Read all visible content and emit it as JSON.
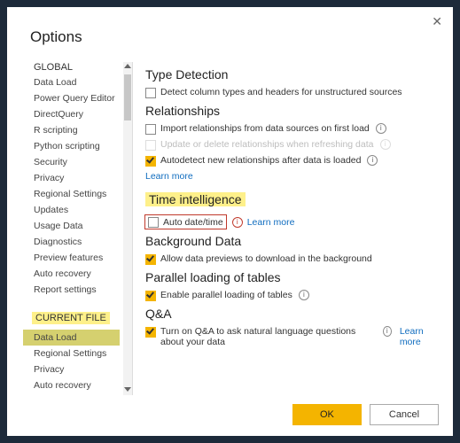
{
  "title": "Options",
  "sidebar": {
    "sections": [
      {
        "label": "GLOBAL",
        "highlight": false,
        "items": [
          {
            "label": "Data Load",
            "selected": false
          },
          {
            "label": "Power Query Editor",
            "selected": false
          },
          {
            "label": "DirectQuery",
            "selected": false
          },
          {
            "label": "R scripting",
            "selected": false
          },
          {
            "label": "Python scripting",
            "selected": false
          },
          {
            "label": "Security",
            "selected": false
          },
          {
            "label": "Privacy",
            "selected": false
          },
          {
            "label": "Regional Settings",
            "selected": false
          },
          {
            "label": "Updates",
            "selected": false
          },
          {
            "label": "Usage Data",
            "selected": false
          },
          {
            "label": "Diagnostics",
            "selected": false
          },
          {
            "label": "Preview features",
            "selected": false
          },
          {
            "label": "Auto recovery",
            "selected": false
          },
          {
            "label": "Report settings",
            "selected": false
          }
        ]
      },
      {
        "label": "CURRENT FILE",
        "highlight": true,
        "items": [
          {
            "label": "Data Load",
            "selected": true
          },
          {
            "label": "Regional Settings",
            "selected": false
          },
          {
            "label": "Privacy",
            "selected": false
          },
          {
            "label": "Auto recovery",
            "selected": false
          }
        ]
      }
    ]
  },
  "content": {
    "sections": [
      {
        "heading": "Type Detection",
        "highlight": false,
        "options": [
          {
            "label": "Detect column types and headers for unstructured sources",
            "checked": false,
            "info": false,
            "muted": false
          }
        ]
      },
      {
        "heading": "Relationships",
        "highlight": false,
        "options": [
          {
            "label": "Import relationships from data sources on first load",
            "checked": false,
            "info": true,
            "muted": false
          },
          {
            "label": "Update or delete relationships when refreshing data",
            "checked": false,
            "info": true,
            "muted": true
          },
          {
            "label": "Autodetect new relationships after data is loaded",
            "checked": true,
            "info": true,
            "muted": false
          }
        ],
        "learn_more": "Learn more"
      },
      {
        "heading": "Time intelligence",
        "highlight": true,
        "time_option": {
          "label": "Auto date/time",
          "info": true,
          "learn_more": "Learn more"
        }
      },
      {
        "heading": "Background Data",
        "highlight": false,
        "options": [
          {
            "label": "Allow data previews to download in the background",
            "checked": true,
            "info": false,
            "muted": false
          }
        ]
      },
      {
        "heading": "Parallel loading of tables",
        "highlight": false,
        "options": [
          {
            "label": "Enable parallel loading of tables",
            "checked": true,
            "info": true,
            "muted": false
          }
        ]
      },
      {
        "heading": "Q&A",
        "highlight": false,
        "options": [
          {
            "label": "Turn on Q&A to ask natural language questions about your data",
            "checked": true,
            "info": true,
            "muted": false
          }
        ],
        "learn_more": "Learn more"
      }
    ]
  },
  "footer": {
    "ok": "OK",
    "cancel": "Cancel"
  }
}
